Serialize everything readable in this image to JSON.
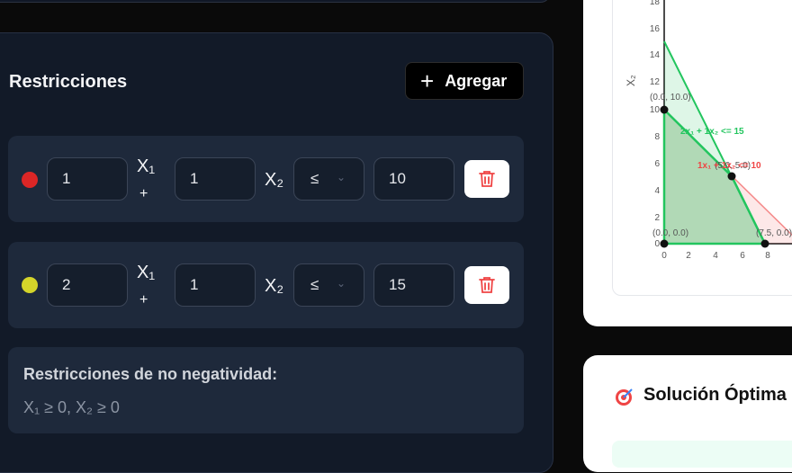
{
  "panel": {
    "title": "Restricciones",
    "add_label": "Agregar"
  },
  "constraints": [
    {
      "color": "#dc2626",
      "coef1": "1",
      "var1": "X₁",
      "op": "+",
      "coef2": "1",
      "var2": "X₂",
      "rel": "≤",
      "rhs": "10"
    },
    {
      "color": "#d4d42a",
      "coef1": "2",
      "var1": "X₁",
      "op": "+",
      "coef2": "1",
      "var2": "X₂",
      "rel": "≤",
      "rhs": "15"
    }
  ],
  "nonneg": {
    "title": "Restricciones de no negatividad:",
    "text": "X₁ ≥ 0, X₂ ≥ 0"
  },
  "graph": {
    "ylabel": "X₂",
    "y_ticks": [
      "18",
      "16",
      "14",
      "12",
      "10",
      "8",
      "6",
      "4",
      "2",
      "0"
    ],
    "x_ticks": [
      "0",
      "2",
      "4",
      "6",
      "8"
    ],
    "labels": {
      "p1": "(0.0, 10.0)",
      "p2": "(5.0, 5.0)",
      "p3": "(0.0, 0.0)",
      "p4": "(7.5, 0.0)",
      "c1": "1x₁ + 1x₂ <= 10",
      "c2": "2x₁ + 1x₂ <= 15"
    }
  },
  "solution": {
    "title": "Solución Óptima"
  }
}
